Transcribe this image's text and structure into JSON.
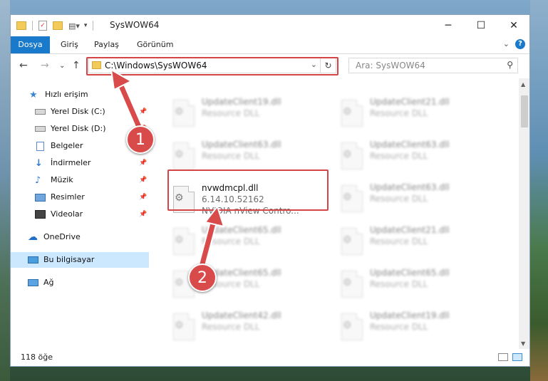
{
  "window": {
    "title": "SysWOW64",
    "controls": {
      "minimize": "─",
      "maximize": "☐",
      "close": "✕"
    }
  },
  "ribbon": {
    "tabs": [
      "Dosya",
      "Giriş",
      "Paylaş",
      "Görünüm"
    ],
    "help": "?"
  },
  "address": {
    "path": "C:\\Windows\\SysWOW64",
    "search_placeholder": "Ara: SysWOW64"
  },
  "sidebar": {
    "items": [
      {
        "label": "Hızlı erişim",
        "icon": "star-icon",
        "pinned": false
      },
      {
        "label": "Yerel Disk (C:)",
        "icon": "drive-icon",
        "pinned": true
      },
      {
        "label": "Yerel Disk (D:)",
        "icon": "drive-icon",
        "pinned": true
      },
      {
        "label": "Belgeler",
        "icon": "documents-icon",
        "pinned": true
      },
      {
        "label": "İndirmeler",
        "icon": "downloads-icon",
        "pinned": true
      },
      {
        "label": "Müzik",
        "icon": "music-icon",
        "pinned": true
      },
      {
        "label": "Resimler",
        "icon": "pictures-icon",
        "pinned": true
      },
      {
        "label": "Videolar",
        "icon": "videos-icon",
        "pinned": true
      },
      {
        "label": "OneDrive",
        "icon": "cloud-icon",
        "pinned": false
      },
      {
        "label": "Bu bilgisayar",
        "icon": "computer-icon",
        "pinned": false,
        "selected": true
      },
      {
        "label": "Ağ",
        "icon": "network-icon",
        "pinned": false
      }
    ]
  },
  "files": {
    "left": [
      {
        "name": "UpdateClient19.dll",
        "desc": "Resource DLL"
      },
      {
        "name": "UpdateClient63.dll",
        "desc": "Resource DLL"
      },
      {
        "name": "nvwdmcpl.dll",
        "version": "6.14.10.52162",
        "desc": "NVIDIA nView Contro..."
      },
      {
        "name": "UpdateClient65.dll",
        "desc": "Resource DLL"
      },
      {
        "name": "UpdateClient65.dll",
        "desc": "Resource DLL"
      },
      {
        "name": "UpdateClient42.dll",
        "desc": "Resource DLL"
      }
    ],
    "right": [
      {
        "name": "UpdateClient21.dll",
        "desc": "Resource DLL"
      },
      {
        "name": "UpdateClient63.dll",
        "desc": "Resource DLL"
      },
      {
        "name": "UpdateClient63.dll",
        "desc": "Resource DLL"
      },
      {
        "name": "UpdateClient21.dll",
        "desc": "Resource DLL"
      },
      {
        "name": "UpdateClient65.dll",
        "desc": "Resource DLL"
      },
      {
        "name": "UpdateClient19.dll",
        "desc": "Resource DLL"
      }
    ]
  },
  "status": {
    "item_count": "118 öğe"
  },
  "annotations": {
    "marker1": "1",
    "marker2": "2",
    "color": "#d94a4a"
  }
}
